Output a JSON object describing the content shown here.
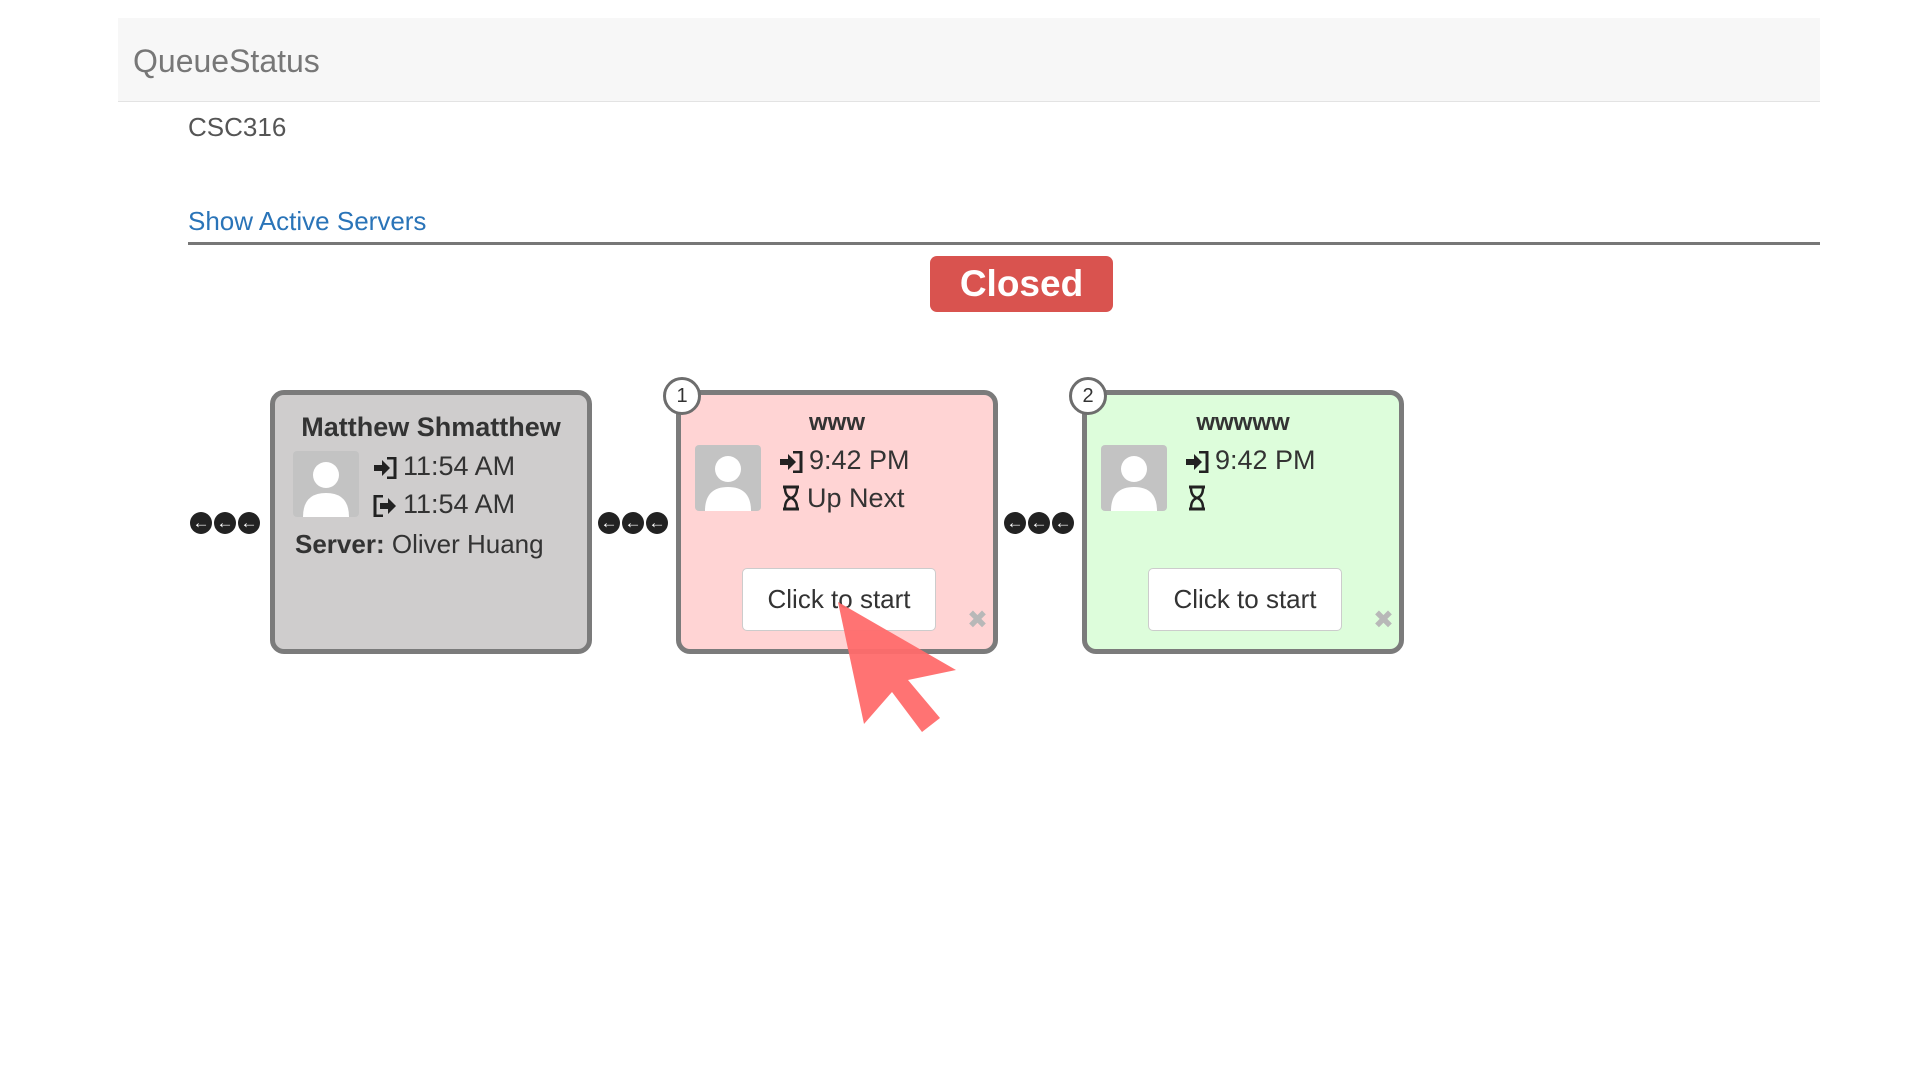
{
  "app": {
    "brand": "QueueStatus"
  },
  "course": {
    "code": "CSC316"
  },
  "links": {
    "show_active_servers": "Show Active Servers"
  },
  "queue": {
    "status": "Closed",
    "status_color": "#d9534f",
    "served": {
      "name": "Matthew Shmatthew",
      "joined": "11:54 AM",
      "left": "11:54 AM",
      "server_label": "Server:",
      "server_name": "Oliver Huang"
    },
    "waiting": [
      {
        "position": "1",
        "name": "www",
        "joined": "9:42 PM",
        "status": "Up Next",
        "button": "Click to start",
        "remove": "✖"
      },
      {
        "position": "2",
        "name": "wwwww",
        "joined": "9:42 PM",
        "status": "",
        "button": "Click to start",
        "remove": "✖"
      }
    ]
  },
  "icons": {
    "queue_arrow": "➔",
    "login": "sign-in-icon",
    "logout": "sign-out-icon",
    "wait": "hourglass-icon",
    "avatar": "user-avatar-icon"
  },
  "colors": {
    "served_card": "#cfcdcd",
    "next_card": "#ffd4d4",
    "waiting_card": "#ddfddb",
    "link": "#2a74b8"
  }
}
